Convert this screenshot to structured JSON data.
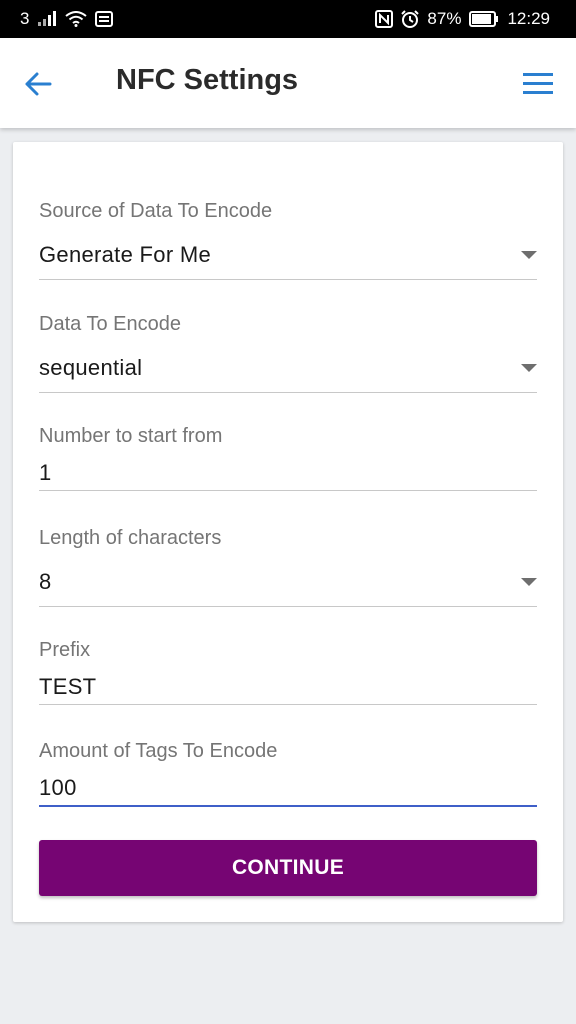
{
  "status_bar": {
    "carrier": "3",
    "battery_percent": "87%",
    "time": "12:29",
    "icons": [
      "signal-icon",
      "wifi-icon",
      "sim-card-icon",
      "nfc-icon",
      "alarm-icon",
      "battery-icon"
    ]
  },
  "app_bar": {
    "title": "NFC Settings",
    "back_icon": "arrow-left-icon",
    "menu_icon": "hamburger-menu-icon",
    "accent_color": "#2a7fd0"
  },
  "form": {
    "source": {
      "label": "Source of Data To Encode",
      "value": "Generate For Me",
      "type": "select"
    },
    "data": {
      "label": "Data To Encode",
      "value": "sequential",
      "type": "select"
    },
    "start_number": {
      "label": "Number to start from",
      "value": "1",
      "type": "input"
    },
    "length": {
      "label": "Length of characters",
      "value": "8",
      "type": "select"
    },
    "prefix": {
      "label": "Prefix",
      "value": "TEST",
      "type": "input"
    },
    "amount": {
      "label": "Amount of Tags To Encode",
      "value": "100",
      "type": "input",
      "focused": true
    }
  },
  "actions": {
    "continue_label": "CONTINUE",
    "continue_color": "#760573"
  }
}
